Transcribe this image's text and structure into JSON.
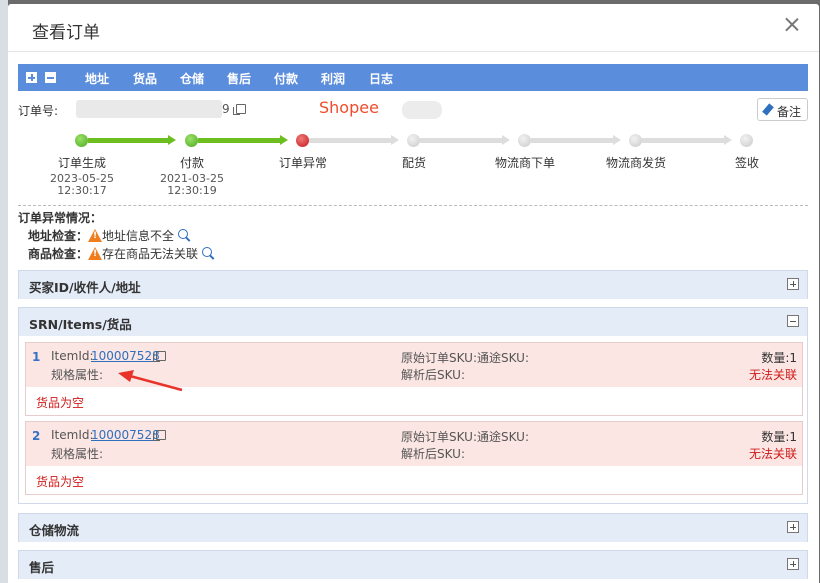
{
  "modal": {
    "title": "查看订单"
  },
  "toolbar": {
    "links": [
      "地址",
      "货品",
      "仓储",
      "售后",
      "付款",
      "利润",
      "日志"
    ]
  },
  "order": {
    "label": "订单号:",
    "number_suffix": "9",
    "platform": "Shopee",
    "note_button": "备注"
  },
  "flow": {
    "steps": [
      {
        "label": "订单生成",
        "date": "2023-05-25",
        "time": "12:30:17",
        "status": "done"
      },
      {
        "label": "付款",
        "date": "2021-03-25",
        "time": "12:30:19",
        "status": "done"
      },
      {
        "label": "订单异常",
        "date": "",
        "time": "",
        "status": "error"
      },
      {
        "label": "配货",
        "date": "",
        "time": "",
        "status": "pending"
      },
      {
        "label": "物流商下单",
        "date": "",
        "time": "",
        "status": "pending"
      },
      {
        "label": "物流商发货",
        "date": "",
        "time": "",
        "status": "pending"
      },
      {
        "label": "签收",
        "date": "",
        "time": "",
        "status": "pending"
      }
    ]
  },
  "anomaly": {
    "heading": "订单异常情况：",
    "address_label": "地址检查：",
    "address_msg": "地址信息不全",
    "goods_label": "商品检查：",
    "goods_msg": "存在商品无法关联"
  },
  "panels": {
    "buyer": "买家ID/收件人/地址",
    "srn": "SRN/Items/货品",
    "warehouse": "仓储物流",
    "aftersale": "售后"
  },
  "items": [
    {
      "index": "1",
      "itemid_label": "ItemId:",
      "itemid": "100007528",
      "spec_label": "规格属性:",
      "sku_label": "原始订单SKU:通途SKU:",
      "parsed_label": "解析后SKU:",
      "qty": "数量:1",
      "link_status": "无法关联",
      "empty": "货品为空"
    },
    {
      "index": "2",
      "itemid_label": "ItemId:",
      "itemid": "100007528",
      "spec_label": "规格属性:",
      "sku_label": "原始订单SKU:通途SKU:",
      "parsed_label": "解析后SKU:",
      "qty": "数量:1",
      "link_status": "无法关联",
      "empty": "货品为空"
    }
  ],
  "colors": {
    "toolbar": "#5b8ddd",
    "done": "#6cbf1e",
    "error": "#c4161c",
    "platform": "#ee4d2d",
    "alert": "#d01a1a"
  }
}
